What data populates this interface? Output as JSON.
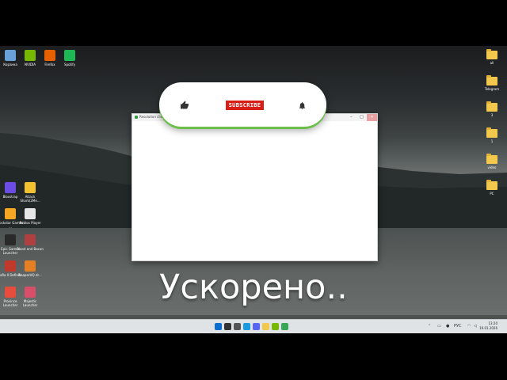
{
  "caption": "Ускорено..",
  "subscribe": {
    "label": "SUBSCRIBE"
  },
  "window": {
    "title": "Resolution clien..."
  },
  "desktop_icons_left_top": [
    {
      "label": "Корзина",
      "icon": "recycle-bin-icon",
      "color": "#6aa0d8"
    },
    {
      "label": "NVIDIA",
      "icon": "nvidia-icon",
      "color": "#76b900"
    },
    {
      "label": "Firefox",
      "icon": "firefox-icon",
      "color": "#e66000"
    },
    {
      "label": "Spotify",
      "icon": "spotify-icon",
      "color": "#1db954"
    }
  ],
  "desktop_icons_left": [
    {
      "label": "Bloxstrap",
      "icon": "bloxstrap-icon",
      "color": "#6b4de6"
    },
    {
      "label": "Attack Shark(2Me...",
      "icon": "attack-shark-icon",
      "color": "#f2c230"
    },
    {
      "label": "Rockstar Games ...",
      "icon": "rockstar-icon",
      "color": "#f5a623"
    },
    {
      "label": "Roblox Player",
      "icon": "roblox-icon",
      "color": "#e6e6e6"
    },
    {
      "label": "Epic Games Launcher",
      "icon": "epic-games-icon",
      "color": "#2a2a2a"
    },
    {
      "label": "Blood and Bacon",
      "icon": "blood-bacon-icon",
      "color": "#b04040"
    },
    {
      "label": "Mafia II Definit...",
      "icon": "mafia-icon",
      "color": "#c0392b"
    },
    {
      "label": "ReaperHQ.dr...",
      "icon": "reaper-icon",
      "color": "#e67e22"
    },
    {
      "label": "Province Launcher",
      "icon": "province-icon",
      "color": "#e74c3c"
    },
    {
      "label": "Majestic Launcher",
      "icon": "majestic-icon",
      "color": "#d94f6a"
    }
  ],
  "desktop_icons_right": [
    {
      "label": "all",
      "icon": "folder-icon"
    },
    {
      "label": "Telegram",
      "icon": "folder-icon"
    },
    {
      "label": "3",
      "icon": "folder-icon"
    },
    {
      "label": "1",
      "icon": "folder-icon"
    },
    {
      "label": "video",
      "icon": "folder-icon"
    },
    {
      "label": "PC",
      "icon": "folder-icon"
    }
  ],
  "taskbar": {
    "icons": [
      {
        "name": "start-icon",
        "color": "#0a6ed1"
      },
      {
        "name": "search-icon",
        "color": "#333333"
      },
      {
        "name": "task-view-icon",
        "color": "#555555"
      },
      {
        "name": "edge-icon",
        "color": "#1a9be0"
      },
      {
        "name": "discord-icon",
        "color": "#5865f2"
      },
      {
        "name": "file-explorer-icon",
        "color": "#f2c94c"
      },
      {
        "name": "nvidia-app-icon",
        "color": "#76b900"
      },
      {
        "name": "resolution-client-icon",
        "color": "#3aa655"
      }
    ],
    "language": "РУС",
    "time": "13:20",
    "date": "19.01.2026"
  }
}
